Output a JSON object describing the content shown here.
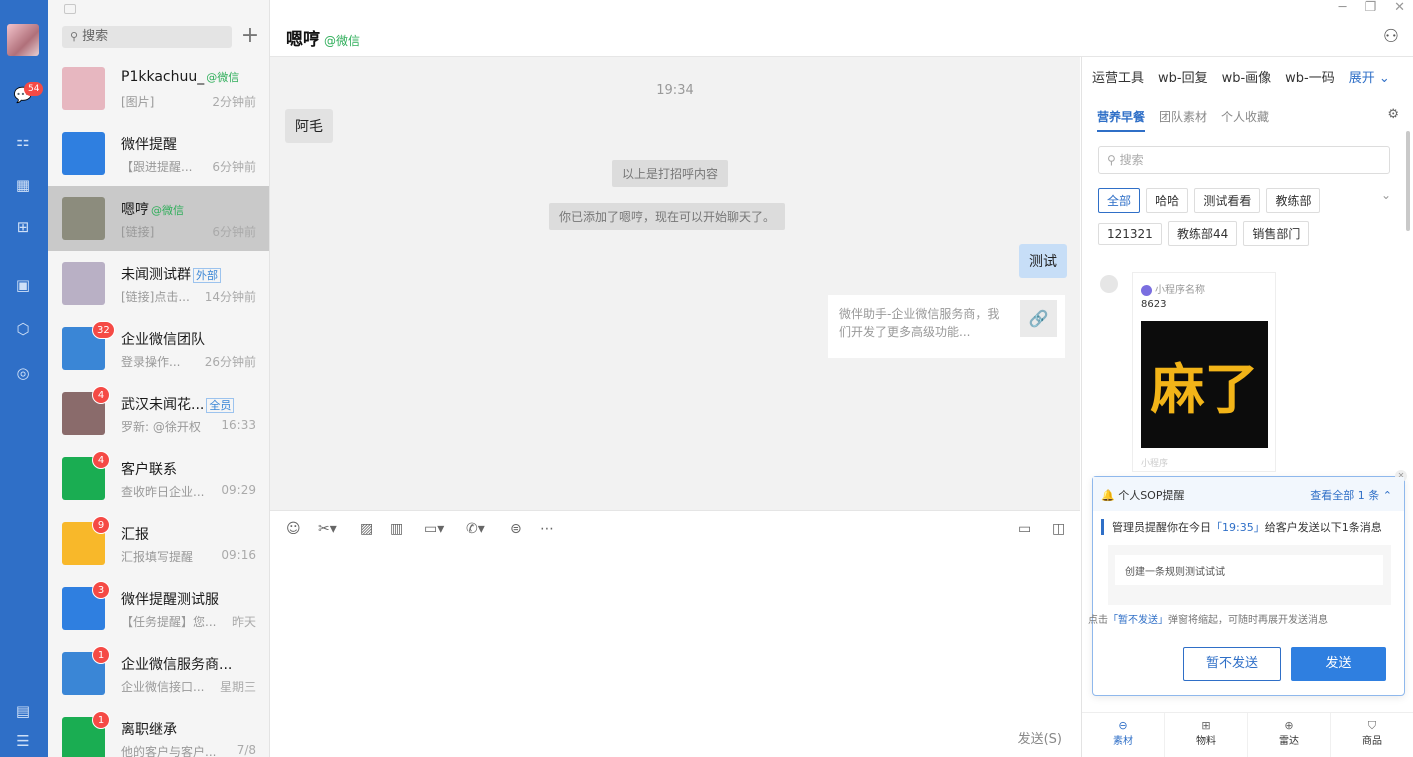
{
  "search": {
    "placeholder": "搜索"
  },
  "rail": {
    "unread_badge": "54"
  },
  "conversations": [
    {
      "name": "P1kkachuu_",
      "tag": "@微信",
      "preview": "[图片]",
      "time": "2分钟前",
      "badge": "",
      "avatar_color": "#e7b7c0"
    },
    {
      "name": "微伴提醒",
      "tag": "",
      "preview": "【跟进提醒...",
      "time": "6分钟前",
      "badge": "",
      "avatar_color": "#2f7fe0"
    },
    {
      "name": "嗯哼",
      "tag": "@微信",
      "preview": "[链接]",
      "time": "6分钟前",
      "badge": "",
      "avatar_color": "#8c8c7d"
    },
    {
      "name": "未闻测试群",
      "tag_blue": "外部",
      "preview": "[链接]点击...",
      "time": "14分钟前",
      "badge": "",
      "avatar_color": "#b9b0c5"
    },
    {
      "name": "企业微信团队",
      "tag": "",
      "preview": "登录操作...",
      "time": "26分钟前",
      "badge": "32",
      "avatar_color": "#3a86d6"
    },
    {
      "name": "武汉未闻花...",
      "tag_blue": "全员",
      "preview": "罗新: @徐开权",
      "time": "16:33",
      "badge": "4",
      "avatar_color": "#8a6b6b"
    },
    {
      "name": "客户联系",
      "tag": "",
      "preview": "查收昨日企业...",
      "time": "09:29",
      "badge": "4",
      "avatar_color": "#1aad52"
    },
    {
      "name": "汇报",
      "tag": "",
      "preview": "汇报填写提醒",
      "time": "09:16",
      "badge": "9",
      "avatar_color": "#f8b82a"
    },
    {
      "name": "微伴提醒测试服",
      "tag": "",
      "preview": "【任务提醒】您...",
      "time": "昨天",
      "badge": "3",
      "avatar_color": "#2f7fe0"
    },
    {
      "name": "企业微信服务商...",
      "tag": "",
      "preview": "企业微信接口...",
      "time": "星期三",
      "badge": "1",
      "avatar_color": "#3a86d6"
    },
    {
      "name": "离职继承",
      "tag": "",
      "preview": "他的客户与客户...",
      "time": "7/8",
      "badge": "1",
      "avatar_color": "#1aad52"
    }
  ],
  "chat": {
    "title": "嗯哼",
    "subtitle": "@微信",
    "time": "19:34",
    "msg_left": "阿毛",
    "sys1": "以上是打招呼内容",
    "sys2": "你已添加了嗯哼，现在可以开始聊天了。",
    "msg_right": "测试",
    "link_text": "微伴助手-企业微信服务商，我们开发了更多高级功能...",
    "send_label": "发送(S)"
  },
  "rpanel": {
    "tabs": [
      "运营工具",
      "wb-回复",
      "wb-画像",
      "wb-一码",
      "展开 ⌄"
    ],
    "subtabs": [
      "营养早餐",
      "团队素材",
      "个人收藏"
    ],
    "search_placeholder": "搜索",
    "chips": [
      "全部",
      "哈哈",
      "测试看看",
      "教练部",
      "121321",
      "教练部44",
      "销售部门"
    ],
    "miniprogram": {
      "name": "小程序名称",
      "title": "8623",
      "image_text": "麻了",
      "footer": "小程序"
    },
    "sop": {
      "title": "个人SOP提醒",
      "view_all": "查看全部 1 条 ⌃",
      "line_pre": "管理员提醒你在今日",
      "line_time": "「19:35」",
      "line_post": "给客户发送以下1条消息",
      "message": "创建一条规则测试试试",
      "hint_pre": "点击",
      "hint_link": "「暂不发送」",
      "hint_post": "弹窗将缩起，可随时再展开发送消息",
      "btn_later": "暂不发送",
      "btn_send": "发送"
    },
    "bottom_nav": [
      "素材",
      "物料",
      "雷达",
      "商品"
    ]
  }
}
